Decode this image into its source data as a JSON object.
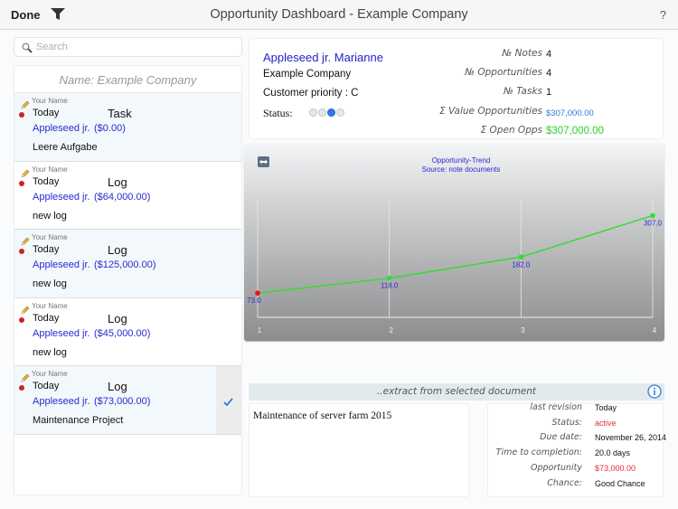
{
  "navbar": {
    "done_label": "Done",
    "filter_icon": "funnel-icon",
    "title": "Opportunity Dashboard - Example Company",
    "help_label": "?"
  },
  "search": {
    "placeholder": "Search",
    "value": ""
  },
  "list": {
    "header": "Name: Example Company",
    "items": [
      {
        "author": "Your Name",
        "date": "Today",
        "type": "Task",
        "contact": "Appleseed jr.",
        "amount": "($0.00)",
        "subject": "Leere Aufgabe",
        "shaded": true,
        "selected": false
      },
      {
        "author": "Your Name",
        "date": "Today",
        "type": "Log",
        "contact": "Appleseed jr.",
        "amount": "($64,000.00)",
        "subject": "new log",
        "shaded": false,
        "selected": false
      },
      {
        "author": "Your Name",
        "date": "Today",
        "type": "Log",
        "contact": "Appleseed jr.",
        "amount": "($125,000.00)",
        "subject": "new log",
        "shaded": true,
        "selected": false
      },
      {
        "author": "Your Name",
        "date": "Today",
        "type": "Log",
        "contact": "Appleseed jr.",
        "amount": "($45,000.00)",
        "subject": "new log",
        "shaded": false,
        "selected": false
      },
      {
        "author": "Your Name",
        "date": "Today",
        "type": "Log",
        "contact": "Appleseed jr.",
        "amount": "($73,000.00)",
        "subject": "Maintenance Project",
        "shaded": true,
        "selected": true
      }
    ]
  },
  "contact_card": {
    "name": "Appleseed jr. Marianne",
    "company": "Example Company",
    "priority": "Customer priority : C",
    "status_label": "Status:",
    "status_level": 3,
    "status_max": 4,
    "stats": [
      {
        "label": "№ Notes",
        "value": "4",
        "style": "plain"
      },
      {
        "label": "№ Opportunities",
        "value": "4",
        "style": "plain"
      },
      {
        "label": "№ Tasks",
        "value": "1",
        "style": "plain"
      },
      {
        "label": "Σ Value Opportunities",
        "value": "$307,000.00",
        "style": "blue"
      },
      {
        "label": "Σ Open Opps",
        "value": "$307,000.00",
        "style": "green"
      }
    ]
  },
  "colors": {
    "accent_blue": "#2222cc",
    "value_blue": "#2a7be0",
    "open_green": "#2bd12b",
    "alert_red": "#e0303a",
    "line_green": "#33dd33",
    "first_point_red": "#ee1111"
  },
  "chart_data": {
    "type": "line",
    "title": "Opportunity-Trend",
    "subtitle": "Source: note documents",
    "x": [
      1,
      2,
      3,
      4
    ],
    "series": [
      {
        "name": "Opportunity-Trend",
        "values": [
          73.0,
          118.0,
          182.0,
          307.0
        ],
        "labels": [
          "73.0",
          "118.0",
          "182.0",
          "307.0"
        ]
      }
    ],
    "x_tick_labels": [
      "1",
      "2",
      "3",
      "4"
    ],
    "xlabel": "",
    "ylabel": "",
    "ylim": [
      0,
      330
    ],
    "grid": true,
    "legend": "none"
  },
  "extract": {
    "label": "..extract from selected document",
    "document_text": "Maintenance of server farm 2015",
    "details": [
      {
        "label": "last revision",
        "value": "Today",
        "style": "plain"
      },
      {
        "label": "Status:",
        "value": "active",
        "style": "red"
      },
      {
        "label": "Due date:",
        "value": "November 26, 2014",
        "style": "plain"
      },
      {
        "label": "Time to completion:",
        "value": "20.0 days",
        "style": "plain"
      },
      {
        "label": "Opportunity",
        "value": "$73,000.00",
        "style": "red"
      },
      {
        "label": "Chance:",
        "value": "Good Chance",
        "style": "plain"
      }
    ]
  }
}
